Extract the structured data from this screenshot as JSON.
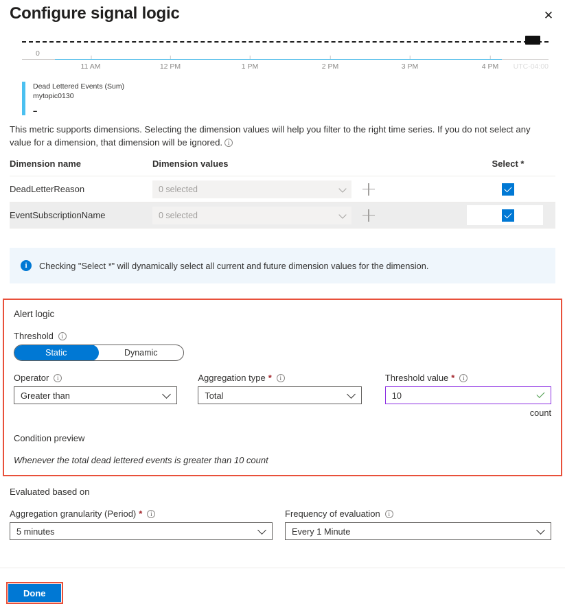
{
  "header": {
    "title": "Configure signal logic",
    "close_label": "✕"
  },
  "chart_data": {
    "type": "line",
    "title": "",
    "series": [
      {
        "name": "Dead Lettered Events (Sum)",
        "resource": "mytopic0130",
        "value": "--",
        "color": "#4bc0f0",
        "values": []
      }
    ],
    "x_ticks": [
      "11 AM",
      "12 PM",
      "1 PM",
      "2 PM",
      "3 PM",
      "4 PM"
    ],
    "y_ticks": [
      "0"
    ],
    "ylim": [
      0,
      1
    ],
    "timezone": "UTC-04:00",
    "grid": false,
    "legend_position": "bottom-left"
  },
  "dimensions": {
    "description": "This metric supports dimensions. Selecting the dimension values will help you filter to the right time series. If you do not select any value for a dimension, that dimension will be ignored.",
    "info_icon": "info-icon",
    "columns": {
      "name": "Dimension name",
      "values": "Dimension values",
      "select": "Select *"
    },
    "rows": [
      {
        "name": "DeadLetterReason",
        "value": "0 selected",
        "add_label": "+",
        "checked": true
      },
      {
        "name": "EventSubscriptionName",
        "value": "0 selected",
        "add_label": "+",
        "checked": true
      }
    ]
  },
  "banner": {
    "icon": "info-icon",
    "text": "Checking \"Select *\" will dynamically select all current and future dimension values for the dimension."
  },
  "alert_logic": {
    "title": "Alert logic",
    "threshold_label": "Threshold",
    "threshold_options": [
      "Static",
      "Dynamic"
    ],
    "threshold_selected": "Static",
    "operator_label": "Operator",
    "operator_value": "Greater than",
    "aggregation_label": "Aggregation type",
    "aggregation_value": "Total",
    "threshold_value_label": "Threshold value",
    "threshold_value": "10",
    "threshold_unit": "count",
    "condition_preview_label": "Condition preview",
    "condition_preview_text": "Whenever the total dead lettered events is greater than 10 count",
    "required_marker": "*",
    "highlight_color": "#e8503a"
  },
  "evaluated": {
    "title": "Evaluated based on",
    "granularity_label": "Aggregation granularity (Period)",
    "granularity_value": "5 minutes",
    "frequency_label": "Frequency of evaluation",
    "frequency_value": "Every 1 Minute",
    "required_marker": "*"
  },
  "footer": {
    "done_label": "Done",
    "highlight_color": "#e8503a",
    "button_color": "#0078d4"
  }
}
